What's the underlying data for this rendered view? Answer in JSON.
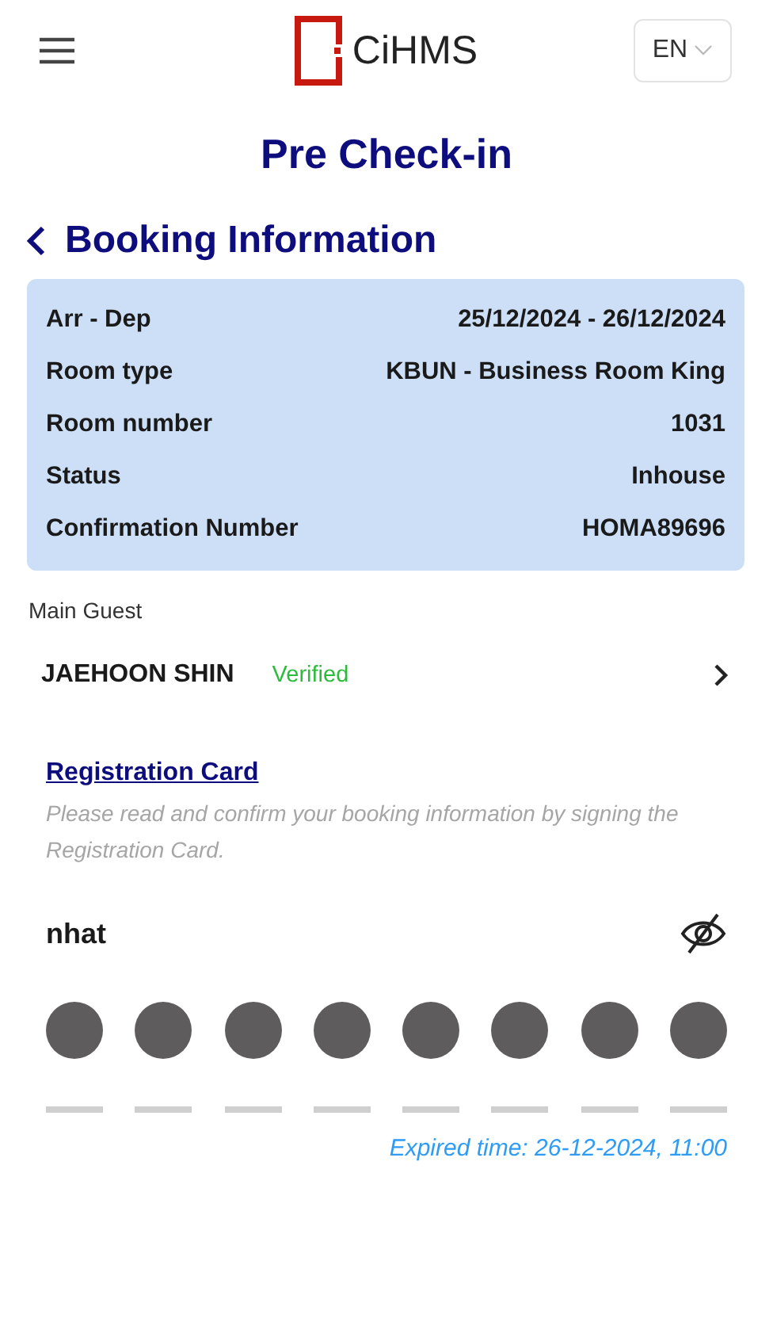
{
  "header": {
    "logo": "CiHMS",
    "language": "EN"
  },
  "page_title": "Pre Check-in",
  "section_title": "Booking Information",
  "booking": [
    {
      "label": "Arr - Dep",
      "value": "25/12/2024 - 26/12/2024"
    },
    {
      "label": "Room type",
      "value": "KBUN - Business Room King"
    },
    {
      "label": "Room number",
      "value": "1031"
    },
    {
      "label": "Status",
      "value": "Inhouse"
    },
    {
      "label": "Confirmation Number",
      "value": "HOMA89696"
    }
  ],
  "main_guest": {
    "label": "Main Guest",
    "name": "JAEHOON SHIN",
    "status": "Verified",
    "verified": true
  },
  "registration": {
    "link": "Registration Card",
    "note": "Please read and confirm your booking information by signing the Registration Card."
  },
  "pin": {
    "label": "nhat",
    "masked": true,
    "slots": [
      {
        "filled": true
      },
      {
        "filled": true
      },
      {
        "filled": true
      },
      {
        "filled": true
      },
      {
        "filled": true
      },
      {
        "filled": true
      },
      {
        "filled": true
      },
      {
        "filled": true
      }
    ],
    "expiry": "Expired time: 26-12-2024, 11:00"
  }
}
